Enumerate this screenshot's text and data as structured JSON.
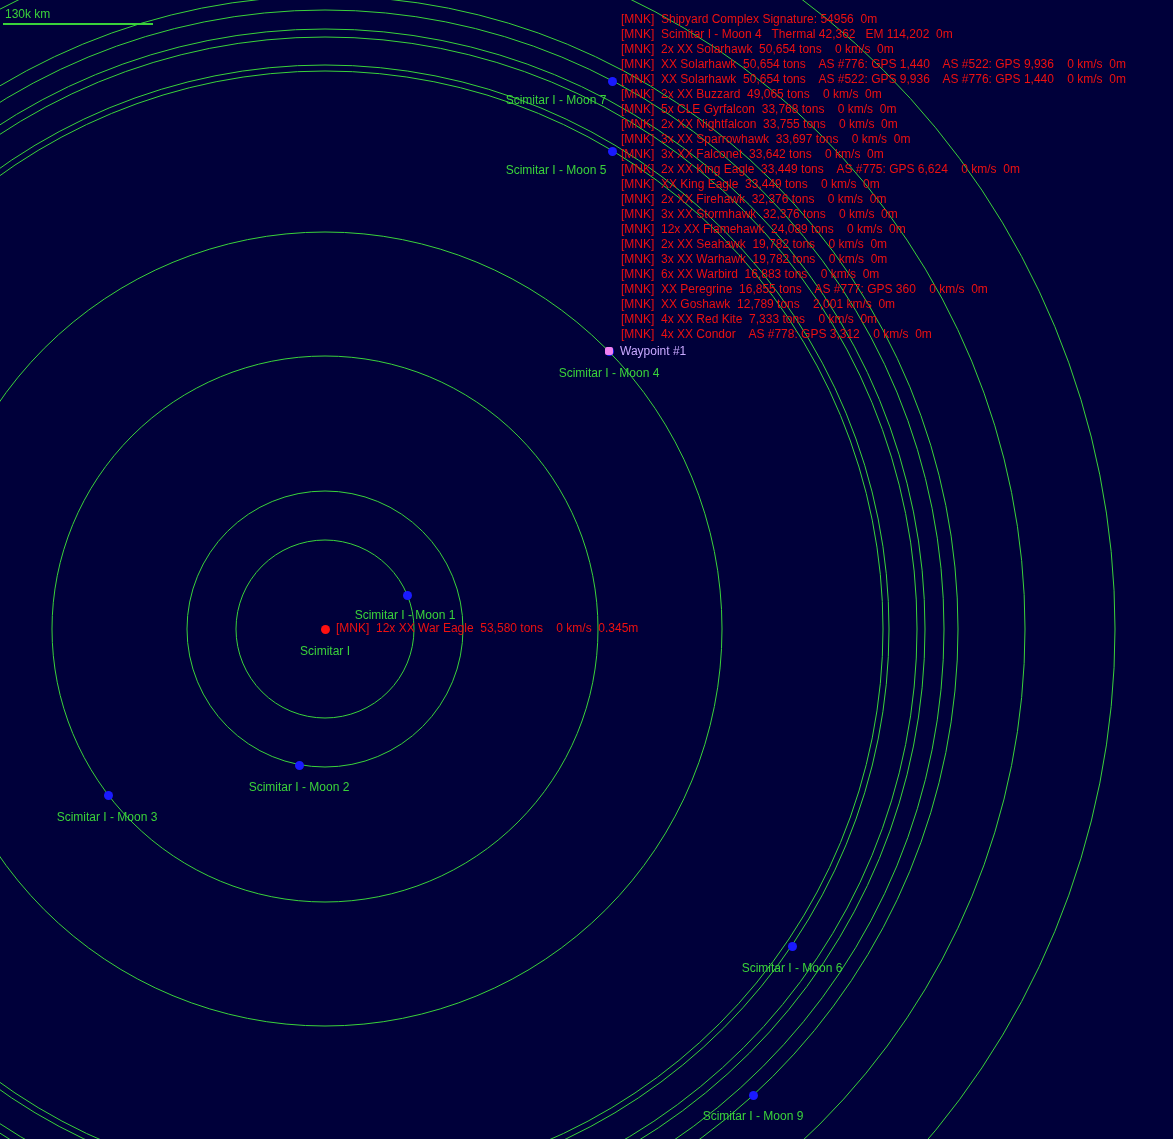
{
  "scale_bar": {
    "label": "130k km"
  },
  "bodies": [
    {
      "name": "Scimitar I",
      "kind": "planet"
    },
    {
      "name": "Scimitar I - Moon 1",
      "kind": "moon"
    },
    {
      "name": "Scimitar I - Moon 2",
      "kind": "moon"
    },
    {
      "name": "Scimitar I - Moon 3",
      "kind": "moon"
    },
    {
      "name": "Scimitar I - Moon 4",
      "kind": "moon"
    },
    {
      "name": "Scimitar I - Moon 5",
      "kind": "moon"
    },
    {
      "name": "Scimitar I - Moon 6",
      "kind": "moon"
    },
    {
      "name": "Scimitar I - Moon 7",
      "kind": "moon"
    },
    {
      "name": "Scimitar I - Moon 9",
      "kind": "moon"
    }
  ],
  "waypoint": {
    "label": "Waypoint #1"
  },
  "fleet_contact": {
    "label": "[MNK]  12x XX War Eagle  53,580 tons    0 km/s  0.345m"
  },
  "contacts": [
    "[MNK]  Shipyard Complex Signature: 54956  0m",
    "[MNK]  Scimitar I - Moon 4   Thermal 42,362   EM 114,202  0m",
    "[MNK]  2x XX Solarhawk  50,654 tons    0 km/s  0m",
    "[MNK]  XX Solarhawk  50,654 tons    AS #776: GPS 1,440    AS #522: GPS 9,936    0 km/s  0m",
    "[MNK]  XX Solarhawk  50,654 tons    AS #522: GPS 9,936    AS #776: GPS 1,440    0 km/s  0m",
    "[MNK]  2x XX Buzzard  49,065 tons    0 km/s  0m",
    "[MNK]  5x CLE Gyrfalcon  33,768 tons    0 km/s  0m",
    "[MNK]  2x XX Nightfalcon  33,755 tons    0 km/s  0m",
    "[MNK]  3x XX Sparrowhawk  33,697 tons    0 km/s  0m",
    "[MNK]  3x XX Falconet  33,642 tons    0 km/s  0m",
    "[MNK]  2x XX King Eagle  33,449 tons    AS #775: GPS 6,624    0 km/s  0m",
    "[MNK]  XX King Eagle  33,449 tons    0 km/s  0m",
    "[MNK]  2x XX Firehawk  32,376 tons    0 km/s  0m",
    "[MNK]  3x XX Stormhawk  32,376 tons    0 km/s  0m",
    "[MNK]  12x XX Flamehawk  24,089 tons    0 km/s  0m",
    "[MNK]  2x XX Seahawk  19,782 tons    0 km/s  0m",
    "[MNK]  3x XX Warhawk  19,782 tons    0 km/s  0m",
    "[MNK]  6x XX Warbird  16,883 tons    0 km/s  0m",
    "[MNK]  XX Peregrine  16,855 tons    AS #777: GPS 360    0 km/s  0m",
    "[MNK]  XX Goshawk  12,789 tons    2,001 km/s  0m",
    "[MNK]  4x XX Red Kite  7,333 tons    0 km/s  0m",
    "[MNK]  4x XX Condor    AS #778: GPS 3,312    0 km/s  0m"
  ]
}
